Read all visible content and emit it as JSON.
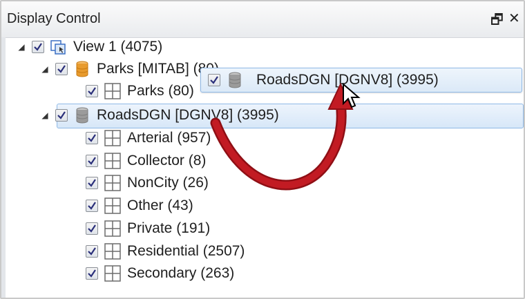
{
  "panel": {
    "title": "Display Control",
    "float_glyph": "🗗",
    "close_glyph": "✕"
  },
  "tree": {
    "view": {
      "label": "View 1 (4075)",
      "checked": true,
      "expanded": true
    },
    "parks_dataset": {
      "label": "Parks [MITAB] (80)",
      "checked": true,
      "expanded": true
    },
    "parks_layer": {
      "label": "Parks (80)",
      "checked": true
    },
    "roads_dataset": {
      "label": "RoadsDGN [DGNV8] (3995)",
      "checked": true,
      "expanded": true,
      "selected": true
    },
    "roads_layers": [
      {
        "label": "Arterial (957)",
        "checked": true
      },
      {
        "label": "Collector (8)",
        "checked": true
      },
      {
        "label": "NonCity (26)",
        "checked": true
      },
      {
        "label": "Other (43)",
        "checked": true
      },
      {
        "label": "Private (191)",
        "checked": true
      },
      {
        "label": "Residential (2507)",
        "checked": true
      },
      {
        "label": "Secondary (263)",
        "checked": true
      }
    ]
  },
  "drag_ghost": {
    "label": "RoadsDGN [DGNV8] (3995)",
    "checked": true
  },
  "colors": {
    "selection_border": "#8eb8e6",
    "arrow": "#b3151d",
    "db_icon": "#e89b2e",
    "db_icon_grey": "#9b9b9b",
    "check": "#2a2f7a"
  }
}
